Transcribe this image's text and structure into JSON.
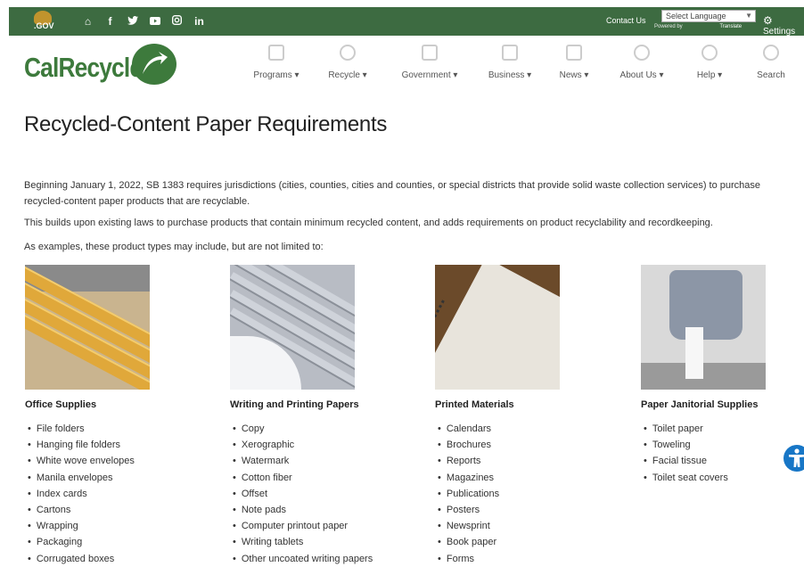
{
  "utility": {
    "logo_text": ".GOV",
    "social_icons": [
      "home-icon",
      "facebook-icon",
      "twitter-icon",
      "youtube-icon",
      "instagram-icon",
      "linkedin-icon"
    ],
    "social_glyphs": [
      "⌂",
      "f",
      "🐦",
      "▶",
      "◎",
      "in"
    ],
    "contact_label": "Contact Us",
    "language_select": "Select Language",
    "powered_by": "Powered by",
    "translate_label": "Translate",
    "settings_label": "Settings",
    "bar_color": "#3d6b41"
  },
  "header": {
    "logo_text": "CalRecycle",
    "brand_color": "#3d7a3c",
    "nav": [
      {
        "label": "Programs ▾",
        "icon": "clipboard-icon"
      },
      {
        "label": "Recycle ▾",
        "icon": "recycle-icon"
      },
      {
        "label": "Government ▾",
        "icon": "capitol-icon"
      },
      {
        "label": "Business ▾",
        "icon": "building-icon"
      },
      {
        "label": "News ▾",
        "icon": "newspaper-icon"
      },
      {
        "label": "About Us ▾",
        "icon": "info-icon"
      },
      {
        "label": "Help ▾",
        "icon": "question-icon"
      },
      {
        "label": "Search",
        "icon": "search-icon"
      }
    ]
  },
  "main": {
    "title": "Recycled-Content Paper Requirements",
    "paragraph1": "Beginning January 1, 2022, SB 1383 requires jurisdictions (cities, counties, cities and counties, or special districts that provide solid waste collection services) to purchase recycled-content paper products that are recyclable.",
    "paragraph2": "This builds upon existing laws to purchase products that contain minimum recycled content, and adds requirements on product recyclability and recordkeeping.",
    "paragraph3": "As examples, these product types may include, but are not limited to:",
    "categories": [
      {
        "heading": "Office Supplies",
        "items": [
          "File folders",
          "Hanging file folders",
          "White wove envelopes",
          "Manila envelopes",
          "Index cards",
          "Cartons",
          "Wrapping",
          "Packaging",
          "Corrugated boxes"
        ]
      },
      {
        "heading": "Writing and Printing Papers",
        "items": [
          "Copy",
          "Xerographic",
          "Watermark",
          "Cotton fiber",
          "Offset",
          "Note pads",
          "Computer printout paper",
          "Writing tablets",
          "Other uncoated writing papers"
        ]
      },
      {
        "heading": "Printed Materials",
        "items": [
          "Calendars",
          "Brochures",
          "Reports",
          "Magazines",
          "Publications",
          "Posters",
          "Newsprint",
          "Book paper",
          "Forms"
        ]
      },
      {
        "heading": "Paper Janitorial Supplies",
        "items": [
          "Toilet paper",
          "Toweling",
          "Facial tissue",
          "Toilet seat covers"
        ]
      }
    ]
  }
}
